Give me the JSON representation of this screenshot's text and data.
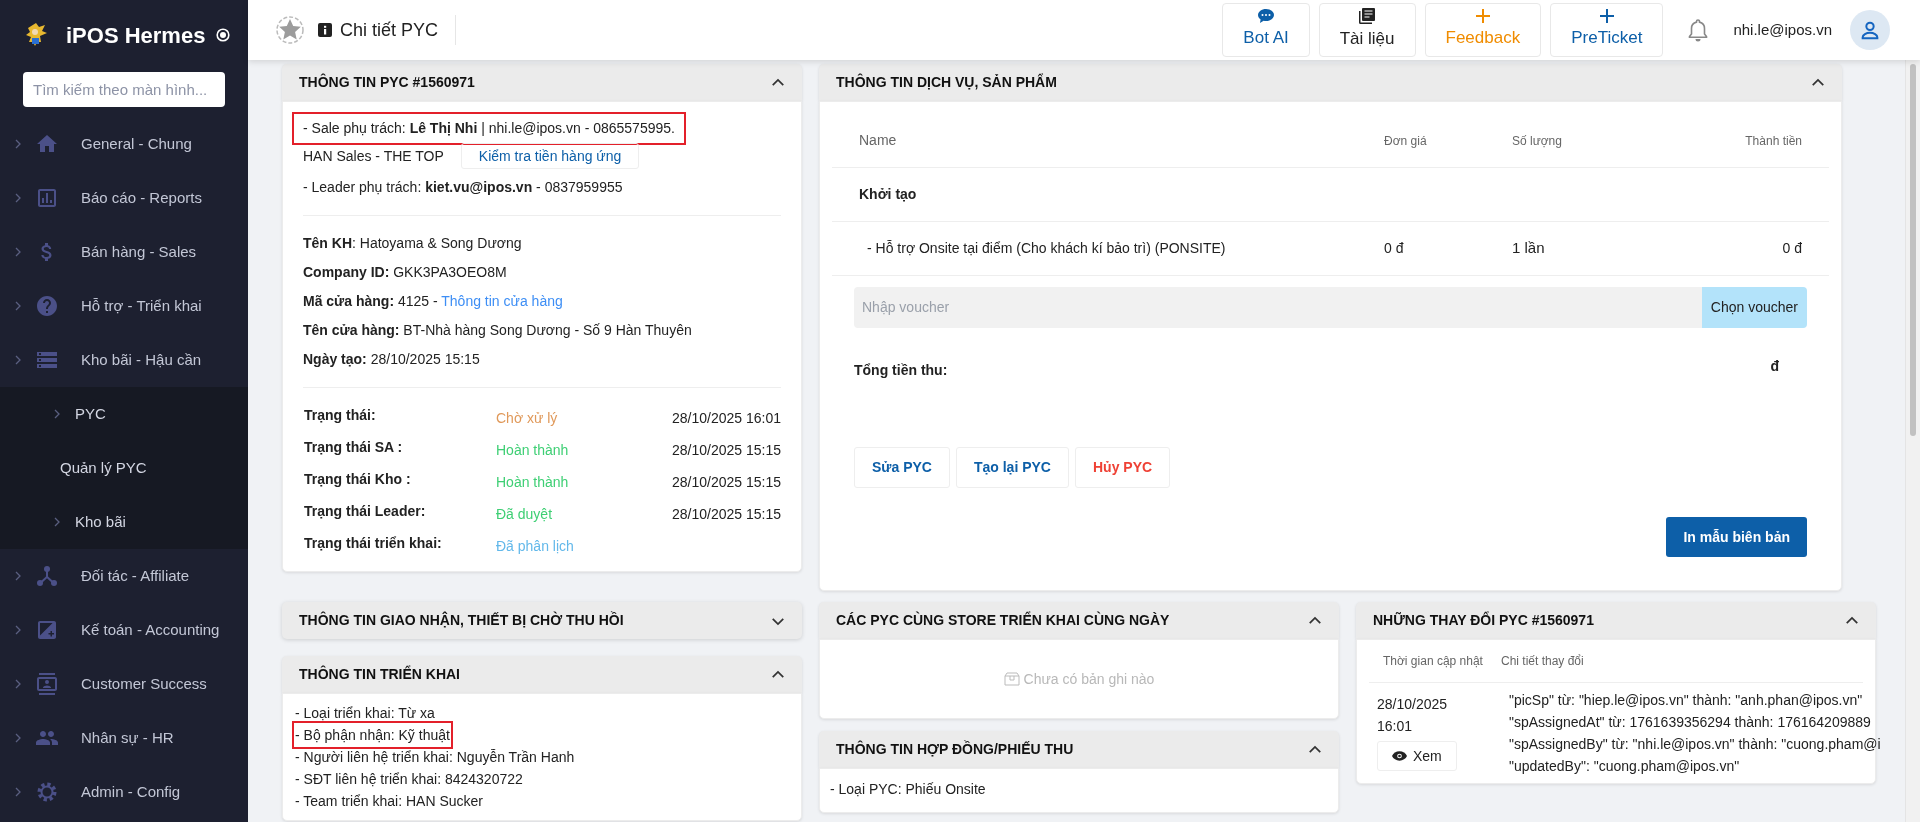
{
  "sidebar": {
    "brand": "iPOS Hermes",
    "search_placeholder": "Tìm kiếm theo màn hình...",
    "items": [
      {
        "label": "General - Chung"
      },
      {
        "label": "Báo cáo - Reports"
      },
      {
        "label": "Bán hàng - Sales"
      },
      {
        "label": "Hỗ trợ - Triển khai"
      },
      {
        "label": "Kho bãi - Hậu cần",
        "children": [
          {
            "label": "PYC",
            "kind": "group"
          },
          {
            "label": "Quản lý PYC",
            "kind": "link"
          },
          {
            "label": "Kho bãi",
            "kind": "group"
          }
        ]
      },
      {
        "label": "Đối tác - Affiliate"
      },
      {
        "label": "Kế toán - Accounting"
      },
      {
        "label": "Customer Success"
      },
      {
        "label": "Nhân sự - HR"
      },
      {
        "label": "Admin - Config"
      }
    ]
  },
  "header": {
    "title": "Chi tiết PYC",
    "actions": [
      {
        "label": "Bot AI",
        "color": "#0d5fa8"
      },
      {
        "label": "Tài liệu",
        "color": "#222222"
      },
      {
        "label": "Feedback",
        "color": "#f08c00"
      },
      {
        "label": "PreTicket",
        "color": "#0d5fa8"
      }
    ],
    "user": "nhi.le@ipos.vn"
  },
  "pyc_info": {
    "title": "THÔNG TIN PYC #1560971",
    "expanded": true,
    "sale_line": {
      "text": "- Sale phụ trách: **Lê Thị Nhi** | nhi.le@ipos.vn - 0865575995.",
      "highlighted": true
    },
    "team": "HAN Sales - THE TOP",
    "check_button": "Kiểm tra tiền hàng ứng",
    "leader_line": "- Leader phụ trách: **kiet.vu@ipos.vn** - 0837959955",
    "customer": [
      {
        "text": "**Tên KH**: Hatoyama & Song Dương"
      },
      {
        "text": "**Company ID:** GKK3PA3OEO8M"
      },
      {
        "text": "**Mã cửa hàng:** 4125 -",
        "link": "Thông tin cửa hàng"
      },
      {
        "text": "**Tên cửa hàng:** BT-Nhà hàng Song Dương - Số 9 Hàn Thuyên"
      },
      {
        "text": "**Ngày tạo:** 28/10/2025 15:15"
      }
    ],
    "statuses": [
      {
        "label": "Trạng thái:",
        "value": "Chờ xử lý",
        "color": "#e0995a",
        "time": "28/10/2025 16:01"
      },
      {
        "label": "Trạng thái SA :",
        "value": "Hoàn thành",
        "color": "#3ecf74",
        "time": "28/10/2025 15:15"
      },
      {
        "label": "Trạng thái Kho :",
        "value": "Hoàn thành",
        "color": "#3ecf74",
        "time": "28/10/2025 15:15"
      },
      {
        "label": "Trạng thái Leader:",
        "value": "Đã duyệt",
        "color": "#3ecf74",
        "time": "28/10/2025 15:15"
      },
      {
        "label": "Trạng thái triển khai:",
        "value": "Đã phân lịch",
        "color": "#62b8ea"
      }
    ]
  },
  "services": {
    "title": "THÔNG TIN DỊCH VỤ, SẢN PHẨM",
    "expanded": true,
    "columns": [
      "Name",
      "Đơn giá",
      "Số lượng",
      "Thành tiền"
    ],
    "rows": [
      {
        "kind": "group",
        "name": "Khởi tạo"
      },
      {
        "kind": "item",
        "name": "- Hỗ trợ Onsite tại điểm (Cho khách kí bảo trì) (PONSITE)",
        "price": "0 đ",
        "qty": "1 lần",
        "total": "0 đ"
      }
    ],
    "voucher_placeholder": "Nhập voucher",
    "voucher_button": "Chọn voucher",
    "total_label": "Tổng tiền thu:",
    "total_value": "đ",
    "buttons": [
      {
        "label": "Sửa PYC",
        "kind": "primary"
      },
      {
        "label": "Tạo lại PYC",
        "kind": "primary"
      },
      {
        "label": "Hủy PYC",
        "kind": "danger"
      }
    ],
    "print_button": "In mẫu biên bản"
  },
  "delivery": {
    "title": "THÔNG TIN GIAO NHẬN, THIẾT BỊ CHỜ THU HỒI",
    "expanded": false
  },
  "deployment": {
    "title": "THÔNG TIN TRIỂN KHAI",
    "expanded": true,
    "lines": [
      {
        "text": "- Loại triển khai: Từ xa",
        "highlighted": false
      },
      {
        "text": "- Bộ phận nhận: Kỹ thuật",
        "highlighted": true
      },
      {
        "text": "- Người liên hệ triển khai: Nguyễn Trần Hanh",
        "highlighted": false
      },
      {
        "text": "- SĐT liên hệ triển khai: 8424320722",
        "highlighted": false
      },
      {
        "text": "- Team triển khai: HAN Sucker",
        "highlighted": false
      }
    ]
  },
  "same_store": {
    "title": "CÁC PYC CÙNG STORE TRIỂN KHAI CÙNG NGÀY",
    "expanded": true,
    "empty": "Chưa có bản ghi nào"
  },
  "contract": {
    "title": "THÔNG TIN HỢP ĐỒNG/PHIẾU THU",
    "expanded": true,
    "lines": [
      "- Loại PYC: Phiếu Onsite"
    ]
  },
  "changes": {
    "title": "NHỮNG THAY ĐỔI PYC #1560971",
    "expanded": true,
    "columns": [
      "Thời gian cập nhật",
      "Chi tiết thay đổi"
    ],
    "rows": [
      {
        "time": "28/10/2025 16:01",
        "view_button": "Xem",
        "details": [
          "\"picSp\" từ: \"hiep.le@ipos.vn\" thành: \"anh.phan@ipos.vn\"",
          "\"spAssignedAt\" từ: 1761639356294 thành: 176164209889",
          "\"spAssignedBy\" từ: \"nhi.le@ipos.vn\" thành: \"cuong.pham@i",
          "\"updatedBy\": \"cuong.pham@ipos.vn\""
        ]
      }
    ]
  }
}
